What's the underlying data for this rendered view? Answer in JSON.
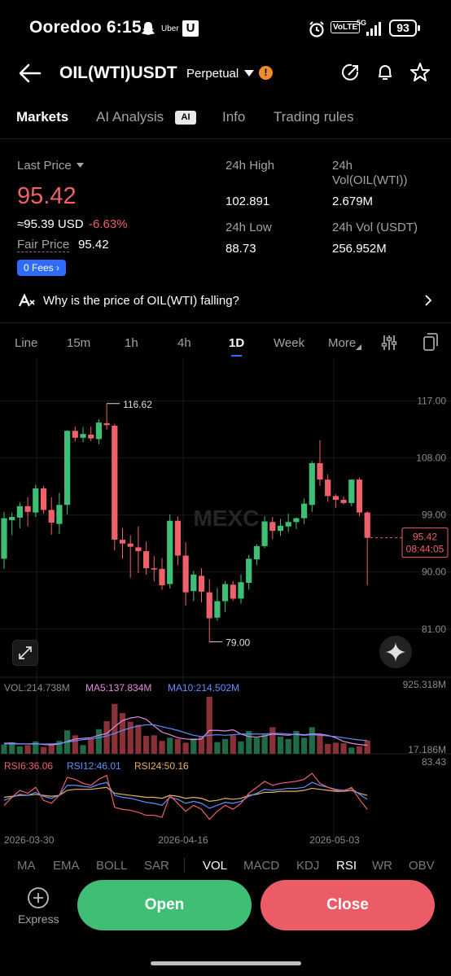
{
  "status_bar": {
    "carrier_time": "Ooredoo 6:15",
    "uber_label": "Uber",
    "u_label": "U",
    "volte": "VoLTE",
    "net": "5G",
    "battery": "93"
  },
  "header": {
    "pair": "OIL(WTI)USDT",
    "contract_type": "Perpetual"
  },
  "tabs": [
    {
      "label": "Markets"
    },
    {
      "label": "AI Analysis"
    },
    {
      "label": "Info"
    },
    {
      "label": "Trading rules"
    }
  ],
  "ai_badge": "AI",
  "summary": {
    "last_price_label": "Last Price",
    "last_price": "95.42",
    "usd_equiv": "≈95.39 USD",
    "change": "-6.63%",
    "fair_price_label": "Fair Price",
    "fair_price": "95.42",
    "fees_label": "0 Fees",
    "high_label": "24h High",
    "high": "102.891",
    "low_label": "24h Low",
    "low": "88.73",
    "vol_base_label_1": "24h",
    "vol_base_label_2": "Vol(OIL(WTI))",
    "vol_base": "2.679M",
    "vol_usdt_label": "24h Vol (USDT)",
    "vol_usdt": "256.952M"
  },
  "ai_question": "Why is the price of OIL(WTI) falling?",
  "timeframes": [
    {
      "label": "Line"
    },
    {
      "label": "15m"
    },
    {
      "label": "1h"
    },
    {
      "label": "4h"
    },
    {
      "label": "1D"
    },
    {
      "label": "Week"
    },
    {
      "label": "More"
    }
  ],
  "chart_data": {
    "type": "candlestick",
    "watermark": "MEXC",
    "price_axis": [
      "117.00",
      "108.00",
      "99.00",
      "90.00",
      "81.00"
    ],
    "ylim": [
      77.5,
      121.2
    ],
    "current_price": "95.42",
    "countdown": "08:44:05",
    "max_label": "116.62",
    "min_label": "79.00",
    "dates": [
      "2026-03-30",
      "2026-04-16",
      "2026-05-03"
    ],
    "candles": [
      {
        "o": 92.1,
        "h": 99.5,
        "l": 90.5,
        "c": 98.5
      },
      {
        "o": 98.2,
        "h": 99.4,
        "l": 95.8,
        "c": 98.7
      },
      {
        "o": 98.6,
        "h": 101.0,
        "l": 96.9,
        "c": 100.4
      },
      {
        "o": 100.4,
        "h": 101.8,
        "l": 97.2,
        "c": 99.5
      },
      {
        "o": 99.4,
        "h": 103.8,
        "l": 98.7,
        "c": 103.2
      },
      {
        "o": 103.2,
        "h": 103.6,
        "l": 99.2,
        "c": 99.8
      },
      {
        "o": 99.8,
        "h": 101.8,
        "l": 95.9,
        "c": 97.8
      },
      {
        "o": 97.6,
        "h": 102.5,
        "l": 96.0,
        "c": 100.6
      },
      {
        "o": 100.6,
        "h": 112.4,
        "l": 99.1,
        "c": 112.3
      },
      {
        "o": 112.3,
        "h": 113.0,
        "l": 110.6,
        "c": 111.2
      },
      {
        "o": 111.2,
        "h": 112.9,
        "l": 110.5,
        "c": 111.8
      },
      {
        "o": 111.7,
        "h": 113.0,
        "l": 110.7,
        "c": 111.1
      },
      {
        "o": 111.0,
        "h": 114.1,
        "l": 110.2,
        "c": 113.6
      },
      {
        "o": 113.5,
        "h": 116.6,
        "l": 112.5,
        "c": 113.2
      },
      {
        "o": 113.1,
        "h": 113.4,
        "l": 93.4,
        "c": 95.1
      },
      {
        "o": 95.1,
        "h": 96.9,
        "l": 92.1,
        "c": 94.5
      },
      {
        "o": 94.5,
        "h": 95.8,
        "l": 89.1,
        "c": 94.0
      },
      {
        "o": 93.9,
        "h": 97.2,
        "l": 89.8,
        "c": 93.3
      },
      {
        "o": 93.3,
        "h": 94.8,
        "l": 89.6,
        "c": 90.6
      },
      {
        "o": 90.6,
        "h": 92.5,
        "l": 88.5,
        "c": 90.4
      },
      {
        "o": 90.5,
        "h": 92.2,
        "l": 87.2,
        "c": 87.9
      },
      {
        "o": 88.1,
        "h": 99.1,
        "l": 87.4,
        "c": 98.1
      },
      {
        "o": 98.1,
        "h": 98.8,
        "l": 91.1,
        "c": 92.6
      },
      {
        "o": 92.6,
        "h": 94.7,
        "l": 84.7,
        "c": 86.8
      },
      {
        "o": 87.0,
        "h": 90.2,
        "l": 85.4,
        "c": 89.6
      },
      {
        "o": 89.4,
        "h": 90.6,
        "l": 85.2,
        "c": 86.9
      },
      {
        "o": 86.8,
        "h": 88.9,
        "l": 79.0,
        "c": 82.7
      },
      {
        "o": 82.8,
        "h": 87.5,
        "l": 82.3,
        "c": 85.4
      },
      {
        "o": 85.4,
        "h": 88.6,
        "l": 83.7,
        "c": 88.1
      },
      {
        "o": 88.0,
        "h": 88.6,
        "l": 85.5,
        "c": 85.8
      },
      {
        "o": 85.8,
        "h": 89.6,
        "l": 85.0,
        "c": 88.4
      },
      {
        "o": 88.3,
        "h": 92.7,
        "l": 87.2,
        "c": 92.1
      },
      {
        "o": 92.0,
        "h": 94.4,
        "l": 91.1,
        "c": 94.1
      },
      {
        "o": 94.1,
        "h": 98.8,
        "l": 93.8,
        "c": 98.0
      },
      {
        "o": 97.9,
        "h": 98.7,
        "l": 95.2,
        "c": 96.5
      },
      {
        "o": 96.5,
        "h": 98.4,
        "l": 95.7,
        "c": 97.3
      },
      {
        "o": 97.2,
        "h": 99.2,
        "l": 96.3,
        "c": 97.9
      },
      {
        "o": 97.9,
        "h": 98.6,
        "l": 96.8,
        "c": 98.5
      },
      {
        "o": 98.5,
        "h": 101.6,
        "l": 97.6,
        "c": 100.8
      },
      {
        "o": 100.6,
        "h": 107.5,
        "l": 99.5,
        "c": 107.2
      },
      {
        "o": 107.2,
        "h": 110.8,
        "l": 103.6,
        "c": 104.6
      },
      {
        "o": 104.6,
        "h": 105.4,
        "l": 101.1,
        "c": 102.0
      },
      {
        "o": 102.0,
        "h": 102.3,
        "l": 100.1,
        "c": 101.4
      },
      {
        "o": 101.4,
        "h": 101.9,
        "l": 100.7,
        "c": 100.9
      },
      {
        "o": 100.9,
        "h": 103.9,
        "l": 100.4,
        "c": 104.6
      },
      {
        "o": 104.6,
        "h": 104.9,
        "l": 98.8,
        "c": 99.4
      },
      {
        "o": 99.4,
        "h": 99.6,
        "l": 87.9,
        "c": 95.4
      }
    ],
    "volume": {
      "label": "VOL:214.738M",
      "ma5_label": "MA5:137.834M",
      "ma10_label": "MA10:214.502M",
      "max_label": "925.318M",
      "min_label": "17.186M",
      "values": [
        150,
        180,
        120,
        140,
        200,
        110,
        160,
        210,
        380,
        300,
        140,
        240,
        400,
        530,
        810,
        660,
        520,
        470,
        290,
        300,
        210,
        260,
        240,
        180,
        250,
        280,
        925,
        190,
        240,
        300,
        200,
        370,
        260,
        310,
        430,
        280,
        240,
        370,
        260,
        430,
        310,
        160,
        180,
        170,
        100,
        120,
        215
      ],
      "ma5": [
        170,
        175,
        160,
        160,
        165,
        150,
        145,
        160,
        200,
        240,
        250,
        260,
        300,
        330,
        440,
        540,
        580,
        600,
        560,
        450,
        350,
        310,
        260,
        240,
        230,
        240,
        380,
        380,
        370,
        390,
        320,
        280,
        270,
        290,
        320,
        310,
        300,
        320,
        310,
        320,
        320,
        300,
        260,
        200,
        170,
        150,
        138
      ],
      "ma10": [
        160,
        162,
        160,
        158,
        160,
        158,
        160,
        168,
        190,
        210,
        230,
        240,
        260,
        290,
        330,
        380,
        420,
        450,
        470,
        470,
        440,
        410,
        380,
        340,
        300,
        280,
        300,
        310,
        300,
        310,
        320,
        320,
        320,
        320,
        330,
        330,
        320,
        310,
        300,
        310,
        300,
        290,
        280,
        260,
        240,
        225,
        214
      ]
    },
    "rsi": {
      "rsi6_label": "RSI6:36.06",
      "rsi12_label": "RSI12:46.01",
      "rsi24_label": "RSI24:50.16",
      "max_label": "83.43",
      "rsi6": [
        40,
        48,
        55,
        52,
        58,
        45,
        42,
        50,
        68,
        66,
        62,
        60,
        66,
        70,
        38,
        36,
        35,
        33,
        30,
        30,
        28,
        50,
        42,
        34,
        40,
        36,
        26,
        34,
        40,
        36,
        42,
        52,
        58,
        64,
        60,
        62,
        63,
        64,
        66,
        72,
        62,
        58,
        55,
        54,
        58,
        46,
        36
      ],
      "rsi12": [
        45,
        48,
        51,
        50,
        53,
        49,
        47,
        50,
        60,
        60,
        59,
        58,
        61,
        63,
        50,
        48,
        47,
        45,
        43,
        42,
        40,
        48,
        46,
        42,
        44,
        42,
        37,
        40,
        43,
        42,
        44,
        49,
        52,
        56,
        55,
        56,
        57,
        57,
        58,
        63,
        60,
        58,
        56,
        55,
        57,
        51,
        46
      ],
      "rsi24": [
        48,
        49,
        50,
        50,
        51,
        50,
        49,
        50,
        55,
        56,
        56,
        56,
        57,
        58,
        52,
        51,
        50,
        49,
        48,
        48,
        47,
        50,
        49,
        47,
        48,
        47,
        44,
        45,
        47,
        46,
        47,
        50,
        51,
        53,
        53,
        54,
        54,
        54,
        55,
        57,
        56,
        55,
        54,
        54,
        55,
        52,
        50
      ]
    }
  },
  "indicator_tabs": [
    {
      "label": "MA"
    },
    {
      "label": "EMA"
    },
    {
      "label": "BOLL"
    },
    {
      "label": "SAR"
    },
    {
      "label": "VOL"
    },
    {
      "label": "MACD"
    },
    {
      "label": "KDJ"
    },
    {
      "label": "RSI"
    },
    {
      "label": "WR"
    },
    {
      "label": "OBV"
    }
  ],
  "actions": {
    "express": "Express",
    "open": "Open",
    "close": "Close"
  },
  "colors": {
    "up": "#3fbf76",
    "down": "#f0606a",
    "ma5": "#e58be0",
    "ma10": "#5f8fff",
    "rsi6": "#f0606a",
    "rsi12": "#5f8fff",
    "rsi24": "#e6b35c"
  }
}
